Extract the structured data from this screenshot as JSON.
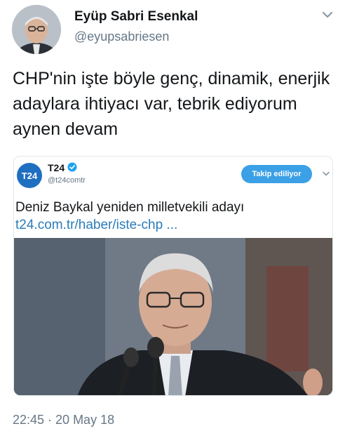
{
  "author": {
    "name": "Eyüp Sabri Esenkal",
    "handle": "@eyupsabriesen"
  },
  "tweet": {
    "text": "CHP'nin işte böyle genç, dinamik, enerjik adaylara ihtiyacı var, tebrik ediyorum aynen devam",
    "timestamp": "22:45 · 20 May 18"
  },
  "quoted": {
    "logo_text": "T24",
    "name": "T24",
    "handle": "@t24comtr",
    "follow_label": "Takip ediliyor",
    "text": "Deniz Baykal yeniden milletvekili adayı",
    "link": "t24.com.tr/haber/iste-chp ..."
  },
  "colors": {
    "accent": "#3ba0e6",
    "link": "#2b7bb9",
    "muted": "#657786",
    "t24_logo": "#1f6fc0"
  },
  "icons": {
    "tweet_menu": "chevron-down-icon",
    "quote_menu": "chevron-down-icon",
    "verified": "verified-badge-icon"
  }
}
